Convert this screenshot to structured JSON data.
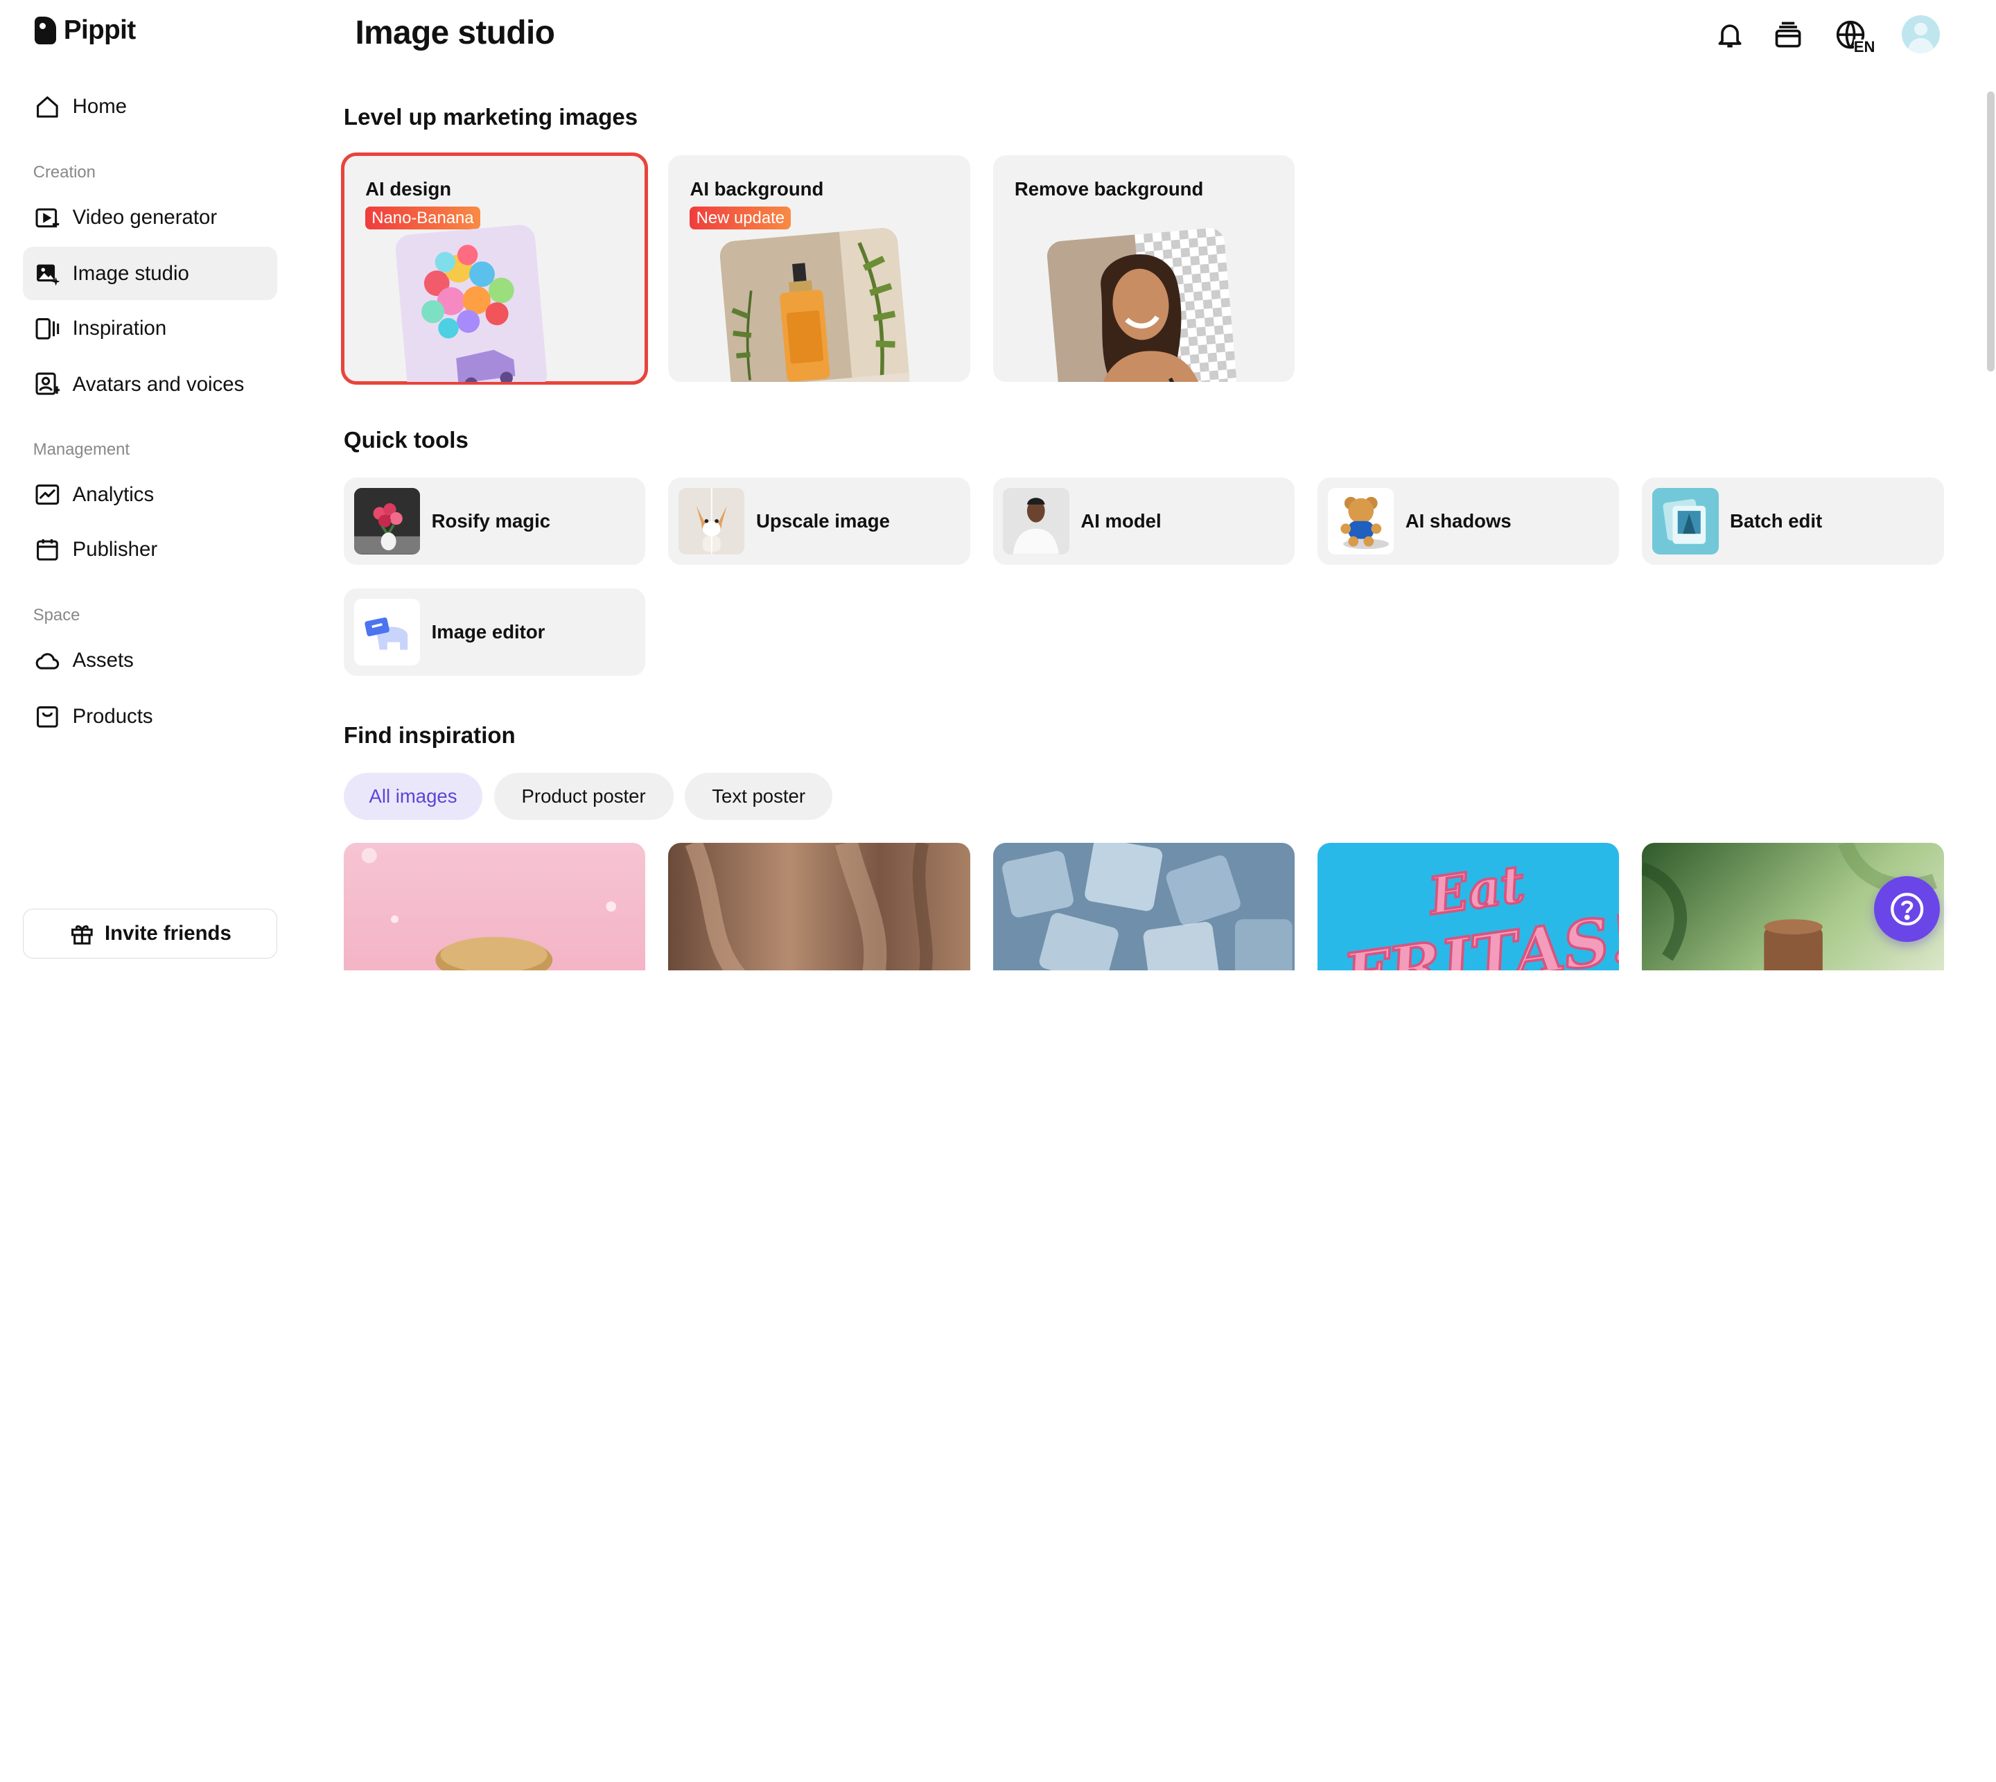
{
  "app": {
    "name": "Pippit"
  },
  "header": {
    "title": "Image studio",
    "language": "EN"
  },
  "sidebar": {
    "home": "Home",
    "sections": {
      "creation": "Creation",
      "management": "Management",
      "space": "Space"
    },
    "items": {
      "video_generator": "Video generator",
      "image_studio": "Image studio",
      "inspiration": "Inspiration",
      "avatars_voices": "Avatars and voices",
      "analytics": "Analytics",
      "publisher": "Publisher",
      "assets": "Assets",
      "products": "Products"
    },
    "invite": "Invite friends"
  },
  "marketing": {
    "title": "Level up marketing images",
    "cards": [
      {
        "title": "AI design",
        "badge": "Nano-Banana"
      },
      {
        "title": "AI background",
        "badge": "New update"
      },
      {
        "title": "Remove background",
        "badge": ""
      }
    ]
  },
  "quick_tools": {
    "title": "Quick tools",
    "items": [
      {
        "label": "Rosify magic"
      },
      {
        "label": "Upscale image"
      },
      {
        "label": "AI model"
      },
      {
        "label": "AI shadows"
      },
      {
        "label": "Batch edit"
      },
      {
        "label": "Image editor"
      }
    ]
  },
  "inspiration": {
    "title": "Find inspiration",
    "filters": [
      "All images",
      "Product poster",
      "Text poster"
    ],
    "active_filter": "All images",
    "poster_text": {
      "line1": "Eat",
      "line2": "FRITAS!"
    }
  },
  "colors": {
    "accent": "#6a46e8",
    "selected_border": "#e8443c",
    "active_chip_text": "#5b45d6",
    "card_bg": "#f2f2f2"
  }
}
